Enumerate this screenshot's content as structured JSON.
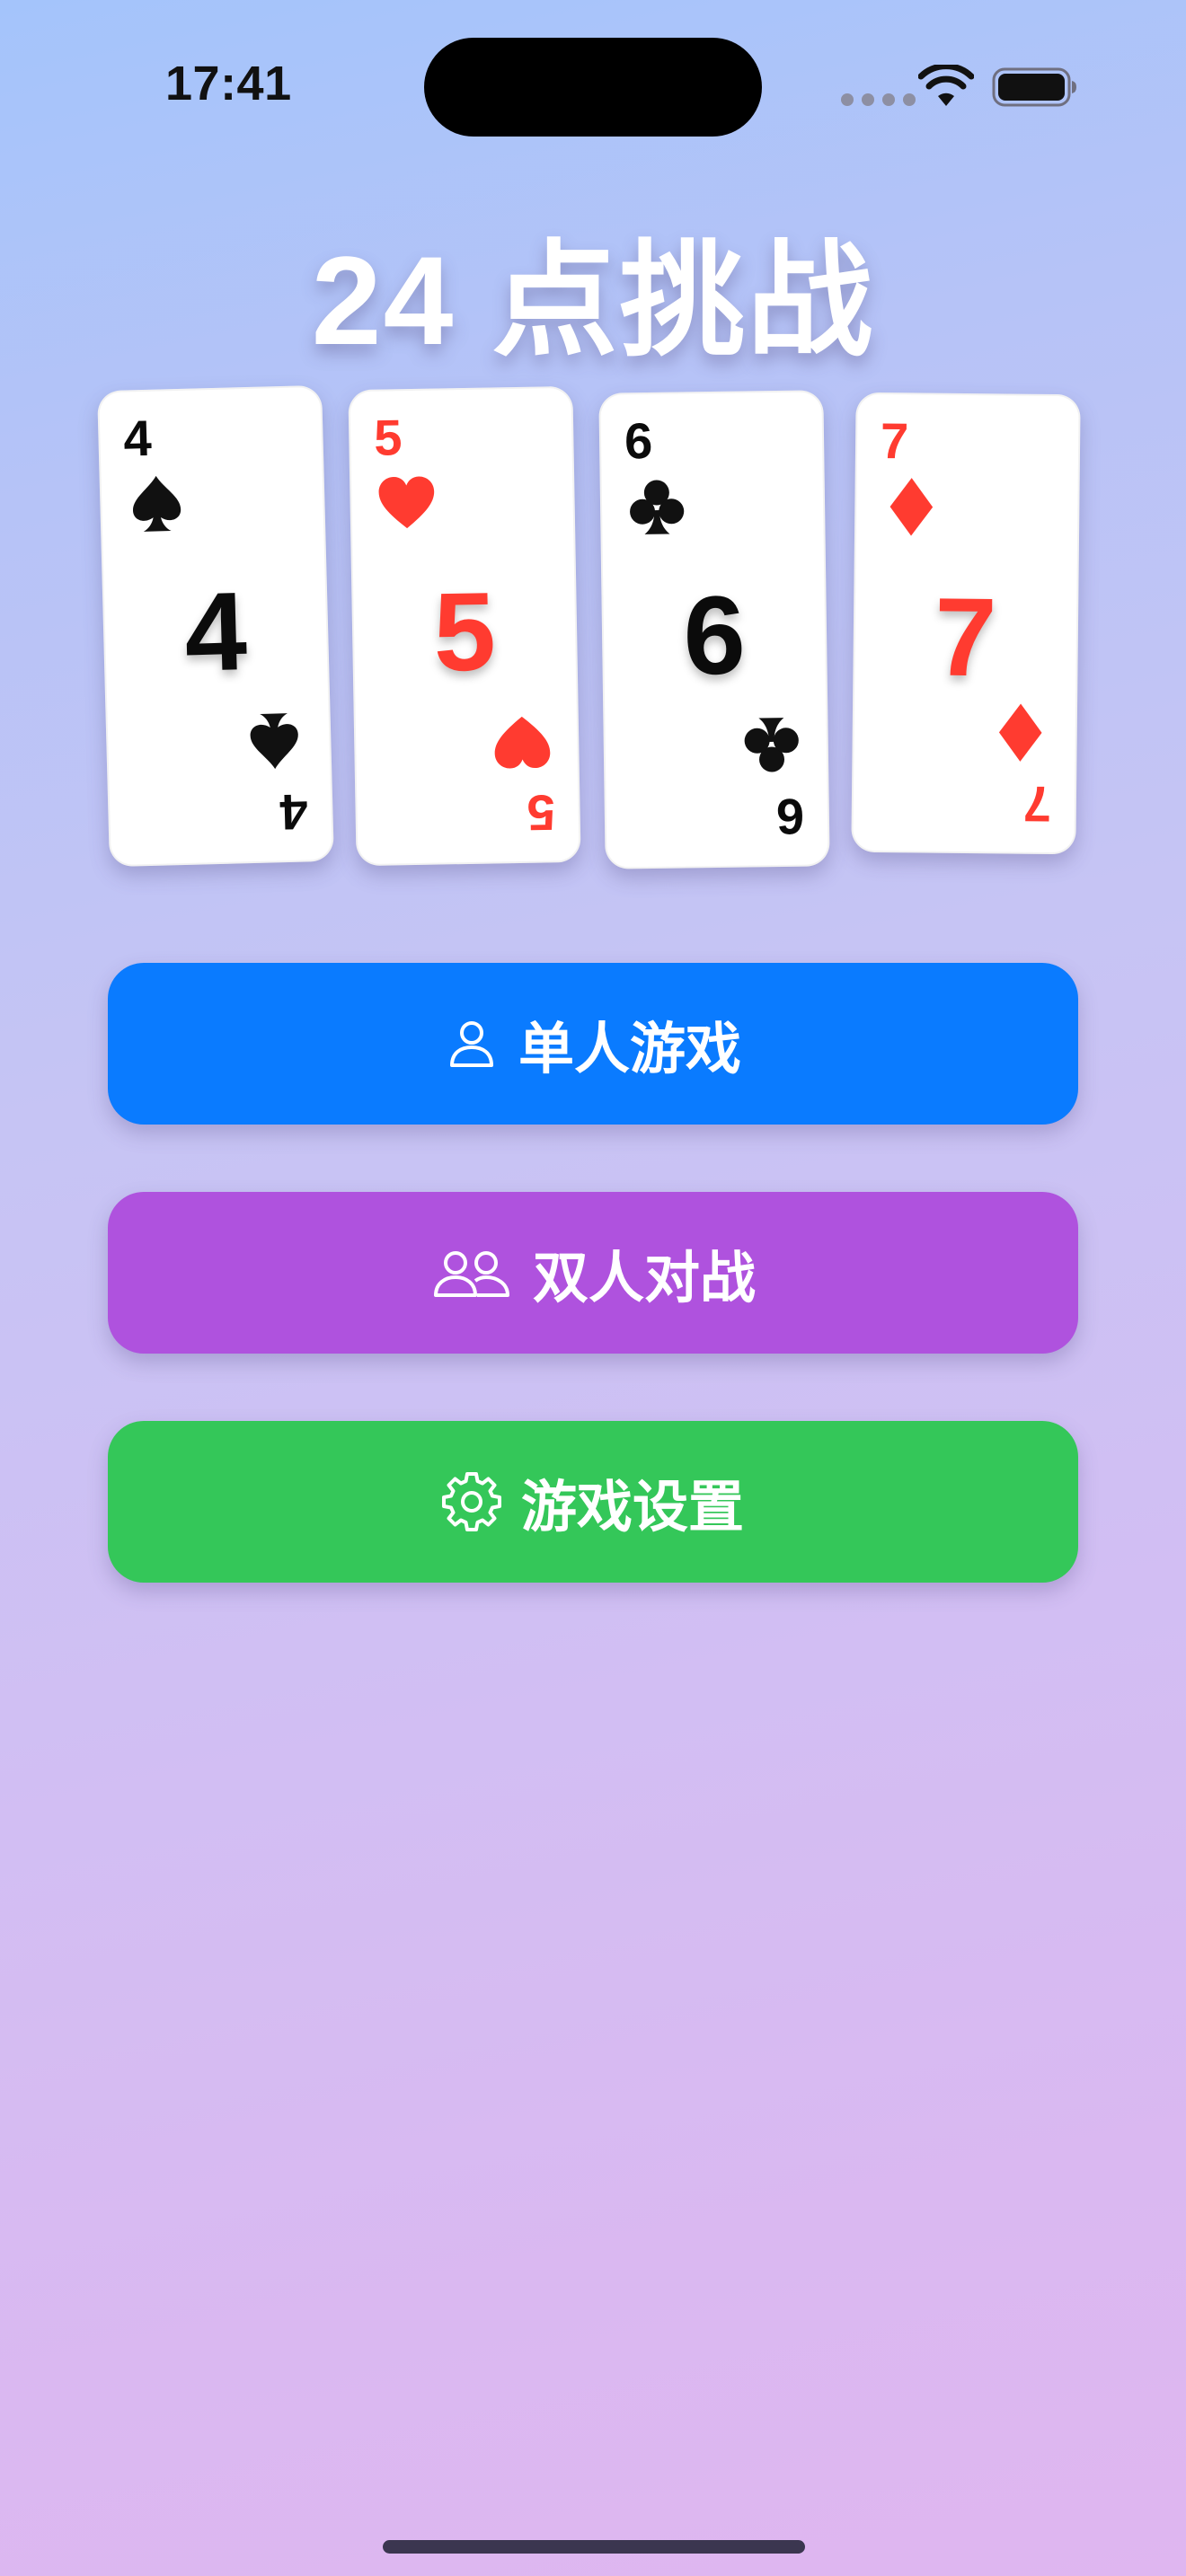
{
  "status_bar": {
    "time": "17:41"
  },
  "title": "24 点挑战",
  "cards": [
    {
      "rank": "4",
      "suit": "spade-icon",
      "color": "#0b0b0b"
    },
    {
      "rank": "5",
      "suit": "heart-icon",
      "color": "#ff3b30"
    },
    {
      "rank": "6",
      "suit": "club-icon",
      "color": "#0b0b0b"
    },
    {
      "rank": "7",
      "suit": "diamond-icon",
      "color": "#ff3b30"
    }
  ],
  "buttons": {
    "single": {
      "label": "单人游戏",
      "icon": "person-icon",
      "color": "#0a7bff"
    },
    "duel": {
      "label": "双人对战",
      "icon": "two-persons-icon",
      "color": "#af52de"
    },
    "settings": {
      "label": "游戏设置",
      "icon": "gear-icon",
      "color": "#34c759"
    }
  }
}
